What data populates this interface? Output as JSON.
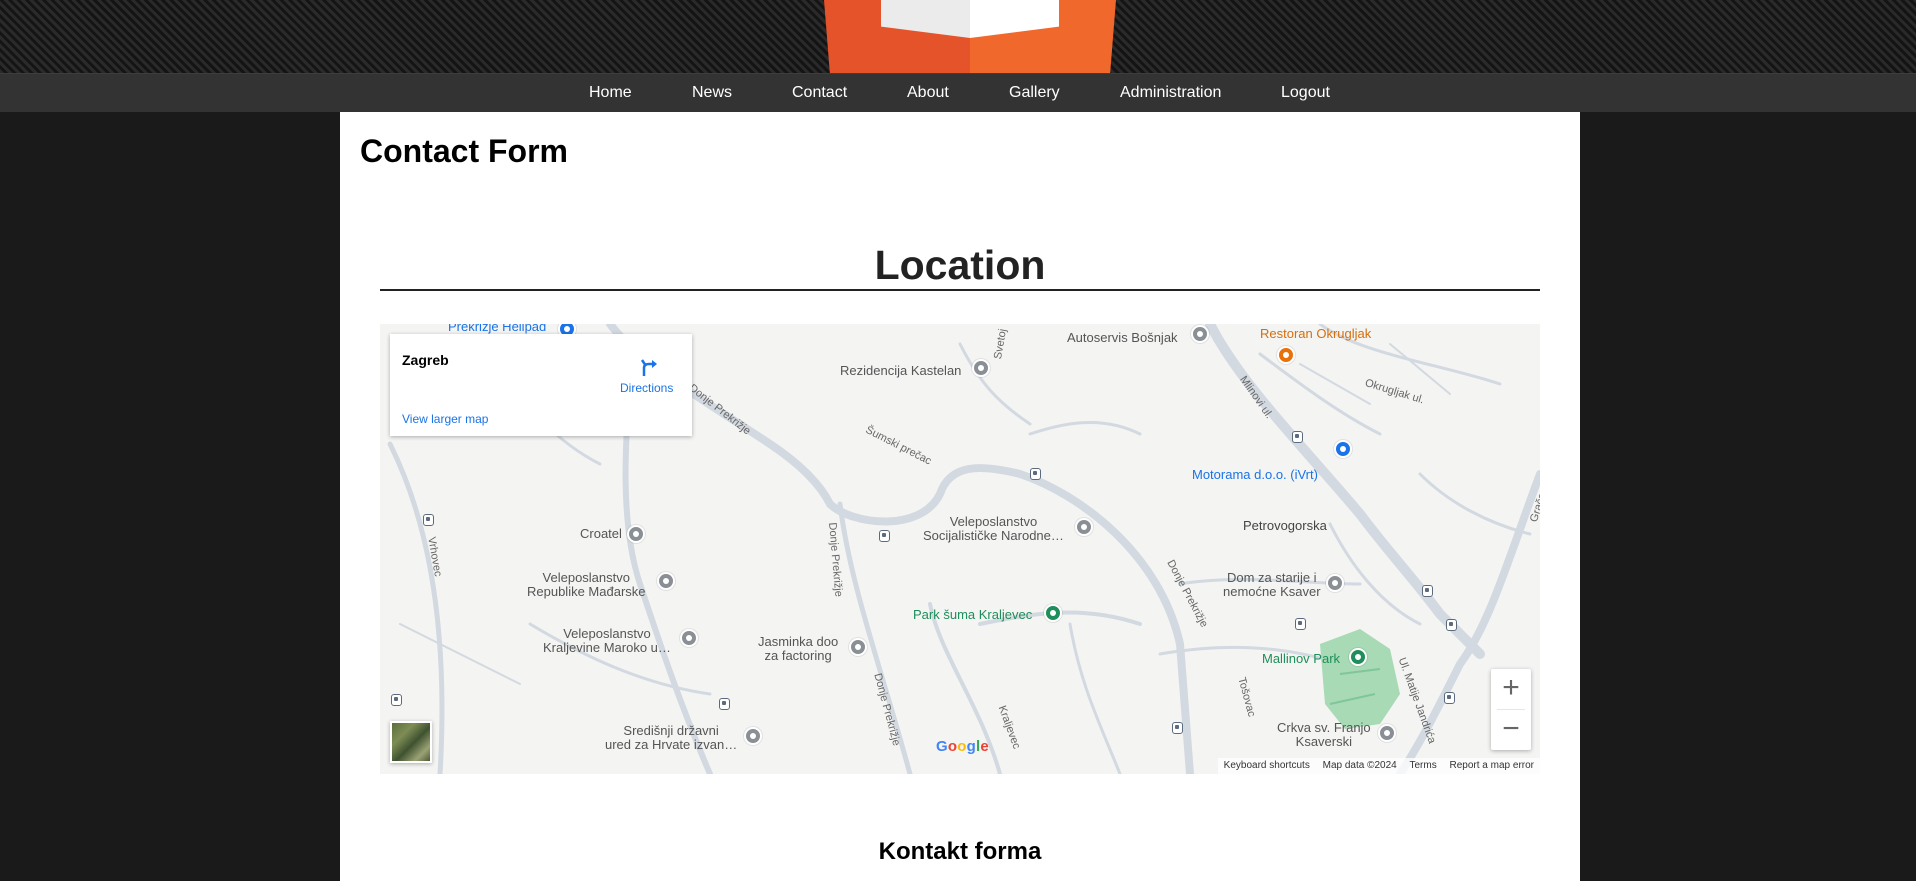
{
  "nav": {
    "items": [
      "Home",
      "News",
      "Contact",
      "About",
      "Gallery",
      "Administration",
      "Logout"
    ]
  },
  "page": {
    "title": "Contact Form",
    "section_title": "Location",
    "form_title": "Kontakt forma"
  },
  "map": {
    "card": {
      "place": "Zagreb",
      "directions": "Directions",
      "view_larger": "View larger map"
    },
    "pois": [
      "Prekrižje Helipad",
      "Autoservis Bošnjak",
      "Restoran Okrugljak",
      "Rezidencija Kastelan",
      "Motorama d.o.o. (iVrt)",
      "Petrovogorska",
      "Croatel",
      "Veleposlanstvo\nSocijalističke Narodne…",
      "Veleposlanstvo\nRepublike Mađarske",
      "Dom za starije i\nnemoćne Ksaver",
      "Park šuma Kraljevec",
      "Veleposlanstvo\nKraljevine Maroko u…",
      "Jasminka doo\nza factoring",
      "Mallinov Park",
      "Središnji državni\nured za Hrvate izvan…",
      "Crkva sv. Franjo\nKsaverski"
    ],
    "streets": [
      "Mlinovi ul.",
      "Okrugljak ul.",
      "Donje Prekrižje",
      "Šumski prečac",
      "Donje Prekrižje",
      "Vrhovec",
      "Gračanska Cesta",
      "Donje Prekrižje",
      "Donje Prekrižje",
      "Ul. Matije Jandrića",
      "Tošovac",
      "Kraljevec",
      "Svetoj"
    ],
    "attribution": {
      "shortcuts": "Keyboard shortcuts",
      "data": "Map data ©2024",
      "terms": "Terms",
      "report": "Report a map error"
    },
    "zoom_in": "+",
    "zoom_out": "−",
    "google_logo": "Google"
  },
  "colors": {
    "nav_bg": "#333333",
    "logo_orange": "#e4532a",
    "link_blue": "#1a73e8",
    "park_green": "#1e8e5a"
  }
}
